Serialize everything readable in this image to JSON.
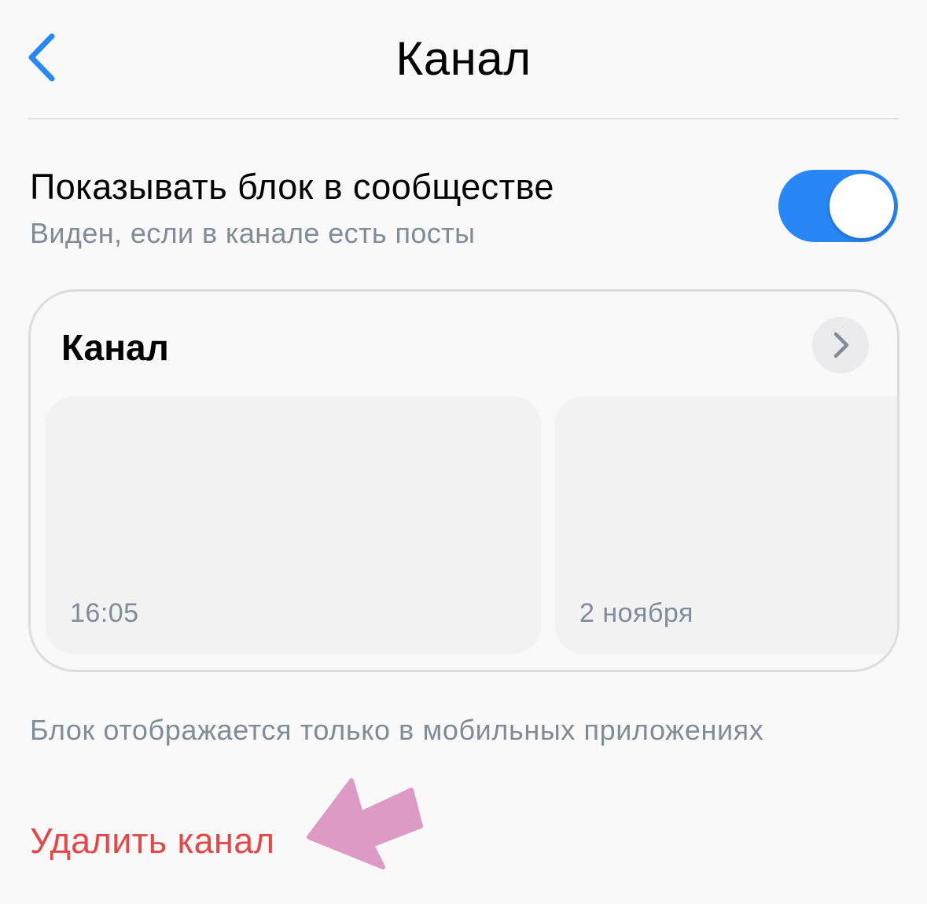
{
  "header": {
    "title": "Канал",
    "back_icon": "chevron-left-icon"
  },
  "setting": {
    "title": "Показывать блок в сообществе",
    "subtitle": "Виден, если в канале есть посты",
    "toggle_on": true
  },
  "card": {
    "title": "Канал",
    "open_icon": "chevron-right-icon",
    "posts": [
      {
        "time": "16:05"
      },
      {
        "time": "2 ноября"
      }
    ]
  },
  "note": "Блок отображается только в мобильных приложениях",
  "delete_label": "Удалить канал",
  "colors": {
    "accent": "#2787f5",
    "danger": "#e64646",
    "secondary_text": "#818c99",
    "annotation_arrow": "#dc9ac5"
  }
}
